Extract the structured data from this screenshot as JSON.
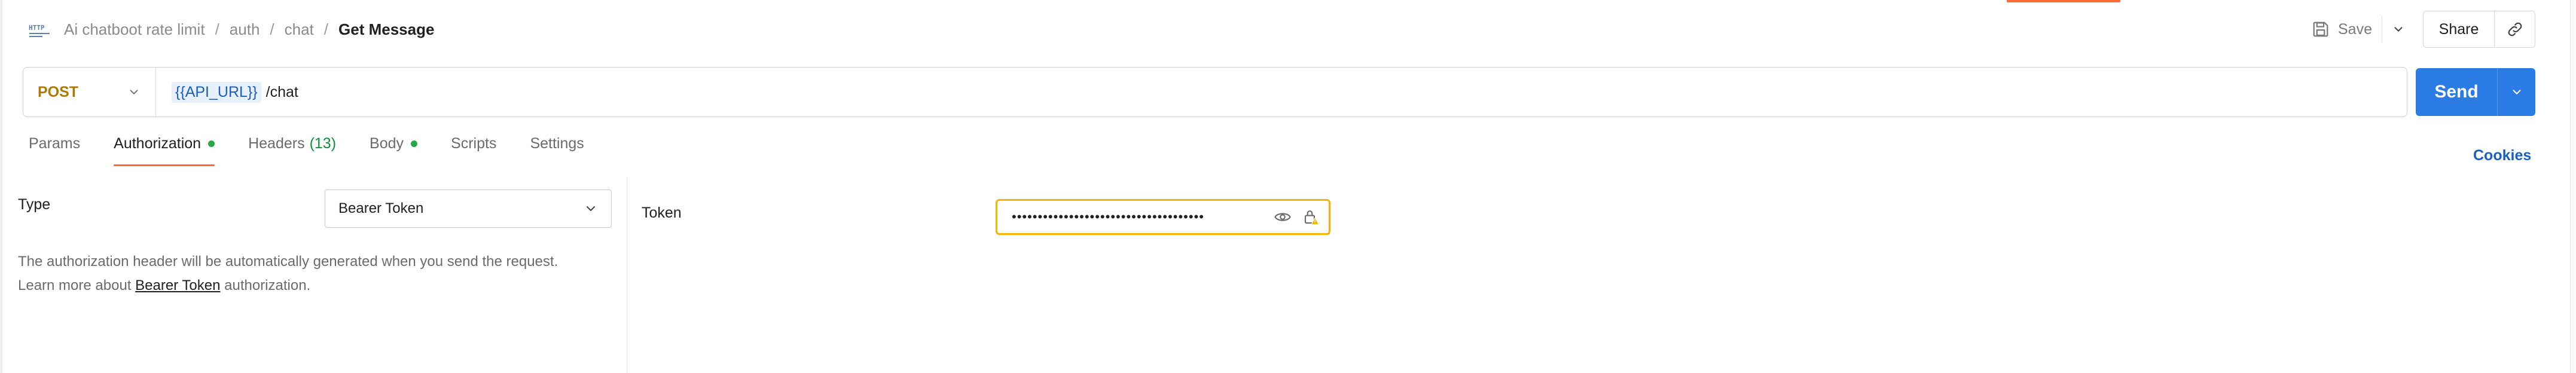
{
  "header": {
    "icon": "http-request-icon",
    "breadcrumb": [
      "Ai chatboot rate limit",
      "auth",
      "chat"
    ],
    "breadcrumb_separator": "/",
    "current": "Get Message",
    "save_label": "Save",
    "share_label": "Share"
  },
  "request": {
    "method": "POST",
    "url_variable": "{{API_URL}}",
    "url_path": "/chat",
    "send_label": "Send"
  },
  "tabs": [
    {
      "label": "Params",
      "active": false
    },
    {
      "label": "Authorization",
      "active": true,
      "dot": true
    },
    {
      "label": "Headers",
      "count": "(13)",
      "active": false
    },
    {
      "label": "Body",
      "active": false,
      "dot": true
    },
    {
      "label": "Scripts",
      "active": false
    },
    {
      "label": "Settings",
      "active": false
    }
  ],
  "cookies_label": "Cookies",
  "auth": {
    "type_label": "Type",
    "type_value": "Bearer Token",
    "description_line1": "The authorization header will be automatically generated when you send the request.",
    "description_line2_prefix": "Learn more about",
    "description_link": "Bearer Token",
    "description_line2_suffix": "authorization."
  },
  "token": {
    "label": "Token",
    "masked_value": "•••••••••••••••••••••••••••••••••••••"
  },
  "colors": {
    "accent": "#ff6c37",
    "send": "#2b7be4",
    "method_post": "#ad7a03",
    "dot_green": "#28a745",
    "token_border": "#f4b400"
  }
}
